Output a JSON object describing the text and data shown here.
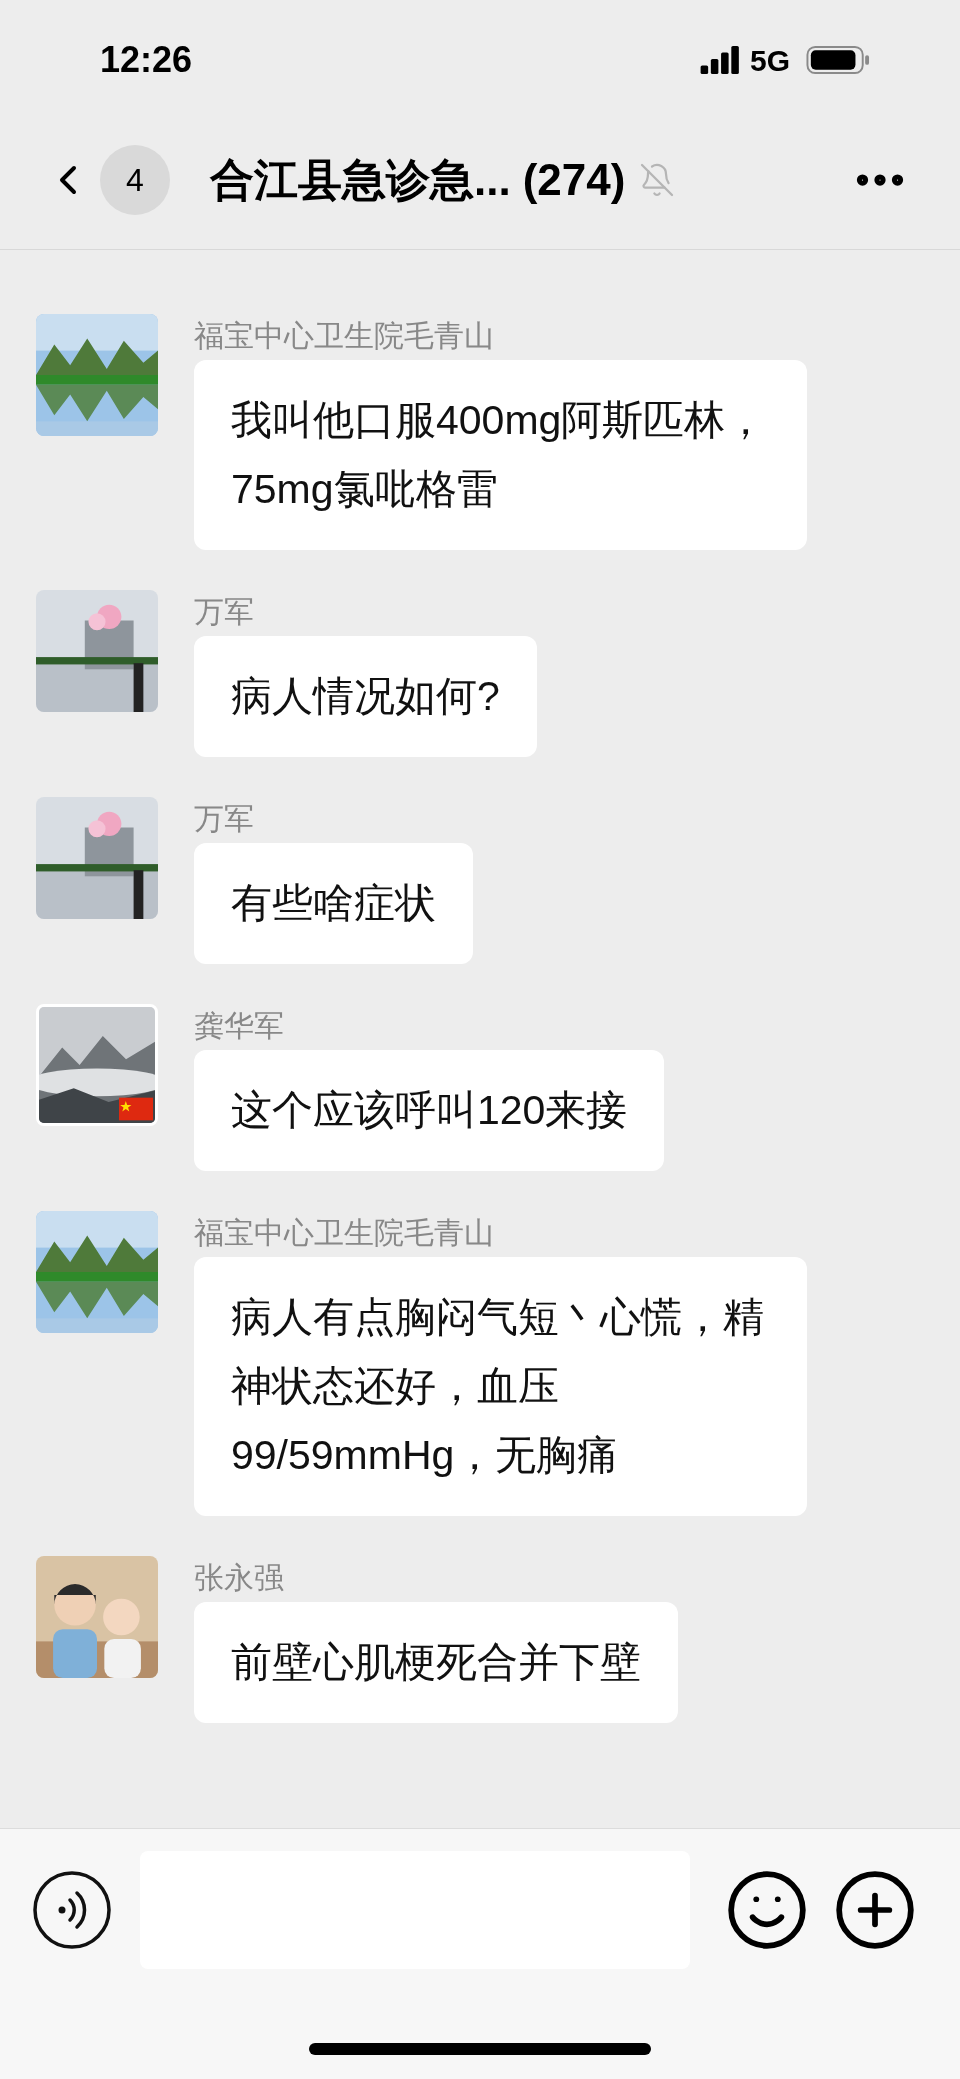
{
  "status_bar": {
    "time": "12:26",
    "network": "5G"
  },
  "header": {
    "unread_count": "4",
    "title": "合江县急诊急...",
    "member_count": "(274)",
    "muted": true
  },
  "messages": [
    {
      "sender": "福宝中心卫生院毛青山",
      "text": "我叫他口服400mg阿斯匹林，75mg氯吡格雷",
      "flag": false
    },
    {
      "sender": "万军",
      "text": "病人情况如何?",
      "flag": false
    },
    {
      "sender": "万军",
      "text": "有些啥症状",
      "flag": false
    },
    {
      "sender": "龚华军",
      "text": "这个应该呼叫120来接",
      "flag": true
    },
    {
      "sender": "福宝中心卫生院毛青山",
      "text": "病人有点胸闷气短丶心慌，精神状态还好，血压99/59mmHg，无胸痛",
      "flag": false
    },
    {
      "sender": "张永强",
      "text": "前壁心肌梗死合并下壁",
      "flag": false
    }
  ]
}
